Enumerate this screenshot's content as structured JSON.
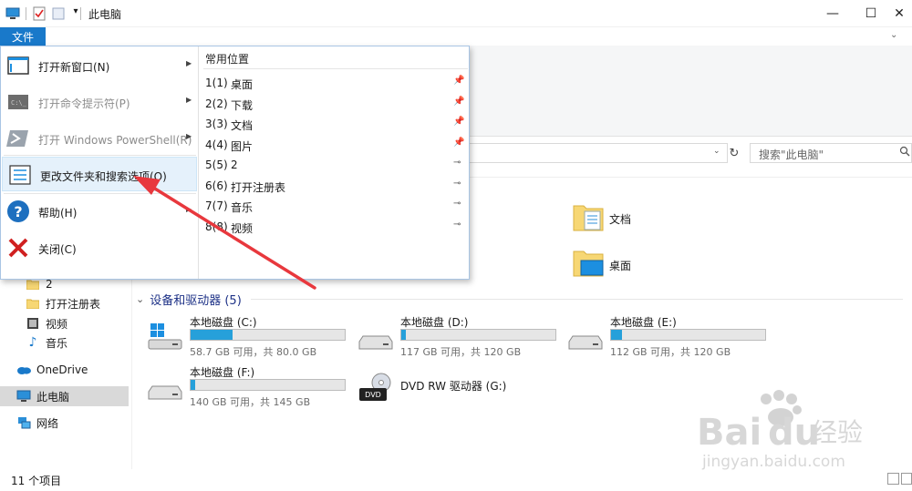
{
  "window": {
    "title": "此电脑",
    "qa_dropdown": "▾",
    "minimize": "—",
    "maximize": "☐",
    "close": "✕",
    "ribbon_expand": "⌄"
  },
  "ribbon": {
    "file_tab": "文件"
  },
  "address": {
    "search_placeholder": "搜索\"此电脑\"",
    "refresh": "↻",
    "dropdown": "⌄"
  },
  "file_menu": {
    "items": [
      {
        "label": "打开新窗口(N)",
        "disabled": false,
        "submenu": true
      },
      {
        "label": "打开命令提示符(P)",
        "disabled": true,
        "submenu": true
      },
      {
        "label": "打开 Windows PowerShell(R)",
        "disabled": true,
        "submenu": true
      },
      {
        "label": "更改文件夹和搜索选项(O)",
        "disabled": false,
        "submenu": false
      },
      {
        "label": "帮助(H)",
        "disabled": false,
        "submenu": true
      },
      {
        "label": "关闭(C)",
        "disabled": false,
        "submenu": false
      }
    ],
    "places_header": "常用位置",
    "places": [
      {
        "num": "1(1)",
        "name": "桌面",
        "pinned": true
      },
      {
        "num": "2(2)",
        "name": "下载",
        "pinned": true
      },
      {
        "num": "3(3)",
        "name": "文档",
        "pinned": true
      },
      {
        "num": "4(4)",
        "name": "图片",
        "pinned": true
      },
      {
        "num": "5(5)",
        "name": "2",
        "pinned": false
      },
      {
        "num": "6(6)",
        "name": "打开注册表",
        "pinned": false
      },
      {
        "num": "7(7)",
        "name": "音乐",
        "pinned": false
      },
      {
        "num": "8(8)",
        "name": "视频",
        "pinned": false
      }
    ]
  },
  "nav": {
    "items": [
      {
        "label": "2",
        "icon": "folder-icon"
      },
      {
        "label": "打开注册表",
        "icon": "folder-icon"
      },
      {
        "label": "视频",
        "icon": "video-icon"
      },
      {
        "label": "音乐",
        "icon": "music-icon"
      },
      {
        "label": "OneDrive",
        "icon": "onedrive-icon"
      },
      {
        "label": "此电脑",
        "icon": "computer-icon",
        "selected": true
      },
      {
        "label": "网络",
        "icon": "network-icon"
      }
    ]
  },
  "folders": [
    {
      "label": "文档"
    },
    {
      "label": "桌面"
    }
  ],
  "devices": {
    "header": "设备和驱动器 (5)",
    "drives": [
      {
        "name": "本地磁盘 (C:)",
        "sub": "58.7 GB 可用，共 80.0 GB",
        "used_fraction": 0.27
      },
      {
        "name": "本地磁盘 (D:)",
        "sub": "117 GB 可用，共 120 GB",
        "used_fraction": 0.03
      },
      {
        "name": "本地磁盘 (E:)",
        "sub": "112 GB 可用，共 120 GB",
        "used_fraction": 0.07
      },
      {
        "name": "本地磁盘 (F:)",
        "sub": "140 GB 可用，共 145 GB",
        "used_fraction": 0.03
      },
      {
        "name": "DVD RW 驱动器 (G:)",
        "sub": "",
        "used_fraction": null
      }
    ]
  },
  "status": {
    "item_count": "11 个项目"
  },
  "watermark": {
    "brand": "Bai",
    "brand2": "du",
    "cn": "经验",
    "url": "jingyan.baidu.com"
  },
  "colors": {
    "accent": "#1979ca",
    "drive_fill": "#26a0da",
    "arrow": "#e8383d"
  }
}
